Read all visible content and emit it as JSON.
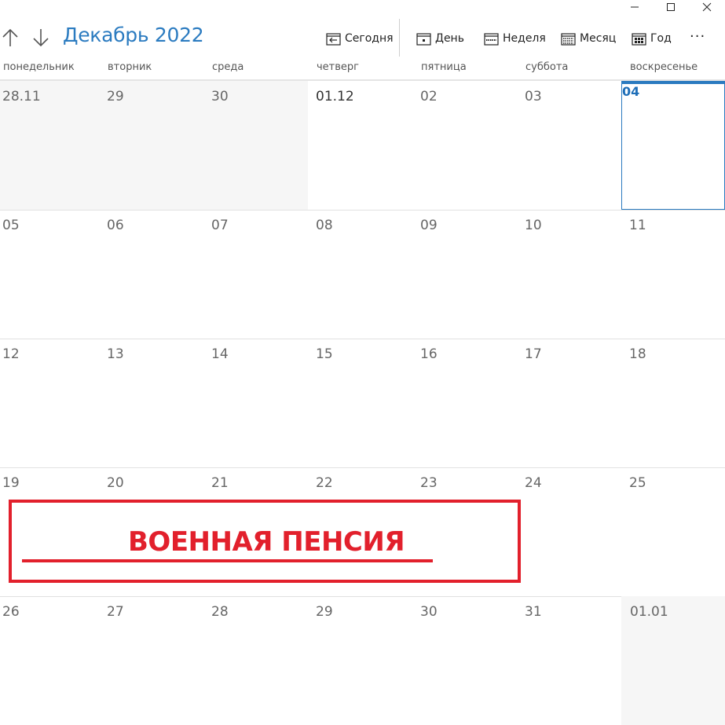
{
  "window": {
    "controls": [
      "minimize",
      "maximize",
      "close"
    ]
  },
  "nav": {
    "title": "Декабрь 2022",
    "up_icon": "arrow-up-icon",
    "down_icon": "arrow-down-icon"
  },
  "toolbar": {
    "today": "Сегодня",
    "day": "День",
    "week": "Неделя",
    "month": "Месяц",
    "year": "Год",
    "more": "···"
  },
  "weekdays": [
    "понедельник",
    "вторник",
    "среда",
    "четверг",
    "пятница",
    "суббота",
    "воскресенье"
  ],
  "weeks": [
    [
      "28.11",
      "29",
      "30",
      "01.12",
      "02",
      "03",
      "04"
    ],
    [
      "05",
      "06",
      "07",
      "08",
      "09",
      "10",
      "11"
    ],
    [
      "12",
      "13",
      "14",
      "15",
      "16",
      "17",
      "18"
    ],
    [
      "19",
      "20",
      "21",
      "22",
      "23",
      "24",
      "25"
    ],
    [
      "26",
      "27",
      "28",
      "29",
      "30",
      "31",
      "01.01"
    ]
  ],
  "today": "04",
  "banner": {
    "text": "ВОЕННАЯ ПЕНСИЯ",
    "color": "#e2202c"
  },
  "colors": {
    "accent": "#2b7bc0",
    "out_of_month_bg": "#f6f6f6"
  }
}
